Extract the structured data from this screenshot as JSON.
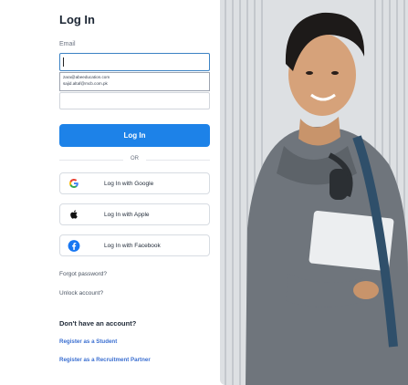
{
  "login": {
    "title": "Log In",
    "email_label": "Email",
    "email_value": "",
    "autofill_suggestions": [
      "zara@abeeducation.com",
      "sajid.altaf@mcb.com.pk"
    ],
    "login_button": "Log In",
    "divider": "OR",
    "social": [
      {
        "icon": "google-icon",
        "label": "Log In with Google"
      },
      {
        "icon": "apple-icon",
        "label": "Log In with Apple"
      },
      {
        "icon": "facebook-icon",
        "label": "Log In with Facebook"
      }
    ],
    "forgot_password": "Forgot password?",
    "unlock_account": "Unlock account?",
    "no_account": "Don't have an account?",
    "register_student": "Register as a Student",
    "register_partner": "Register as a Recruitment Partner"
  },
  "colors": {
    "primary": "#1d82e8",
    "link": "#3b6fd1",
    "facebook": "#1877f2"
  }
}
